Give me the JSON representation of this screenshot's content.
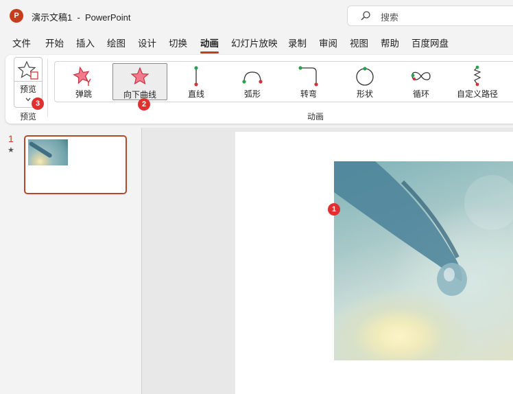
{
  "titlebar": {
    "doc_title": "演示文稿1  -  PowerPoint",
    "search_placeholder": "搜索"
  },
  "tabs": [
    "文件",
    "开始",
    "插入",
    "绘图",
    "设计",
    "切换",
    "动画",
    "幻灯片放映",
    "录制",
    "审阅",
    "视图",
    "帮助",
    "百度网盘"
  ],
  "active_tab": "动画",
  "ribbon": {
    "preview_button": "预览",
    "preview_group": "预览",
    "animation_group": "动画",
    "gallery": [
      {
        "label": "弹跳",
        "icon": "bounce-star-icon"
      },
      {
        "label": "向下曲线",
        "icon": "star-icon",
        "selected": true
      },
      {
        "label": "直线",
        "icon": "line-path-icon"
      },
      {
        "label": "弧形",
        "icon": "arc-path-icon"
      },
      {
        "label": "转弯",
        "icon": "turn-path-icon"
      },
      {
        "label": "形状",
        "icon": "shape-path-icon"
      },
      {
        "label": "循环",
        "icon": "loop-path-icon"
      },
      {
        "label": "自定义路径",
        "icon": "custom-path-icon"
      }
    ]
  },
  "badges": {
    "slide_object": "1",
    "gallery_item": "2",
    "preview": "3"
  },
  "slides_panel": {
    "slide_number": "1",
    "star": "★"
  },
  "colors": {
    "accent": "#c43e1c",
    "badge": "#e03030"
  }
}
